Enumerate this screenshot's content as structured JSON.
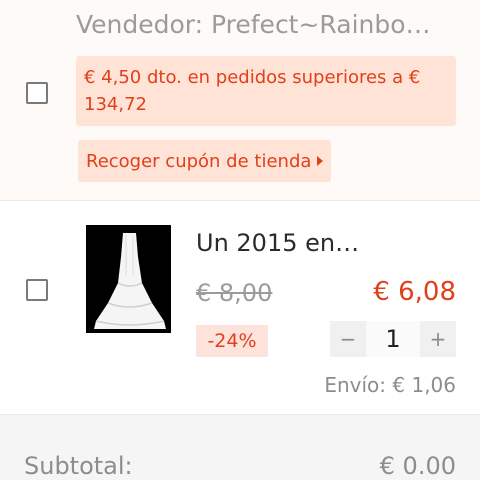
{
  "seller": {
    "name": "Vendedor: Prefect~Rainbo…",
    "promo_text": "€ 4,50 dto. en pedidos superiores a € 134,72",
    "coupon_label": "Recoger cupón de tienda"
  },
  "product": {
    "title": "Un 2015 en…",
    "original_price": "€ 8,00",
    "sale_price": "€ 6,08",
    "discount": "-24%",
    "quantity": "1",
    "qty_minus": "−",
    "qty_plus": "+",
    "shipping": "Envío: € 1,06"
  },
  "summary": {
    "subtotal_label": "Subtotal:",
    "subtotal_value": "€ 0.00"
  },
  "colors": {
    "accent": "#e1401a",
    "promo_bg": "#ffe3d6",
    "muted_text": "#9b9b9b"
  }
}
